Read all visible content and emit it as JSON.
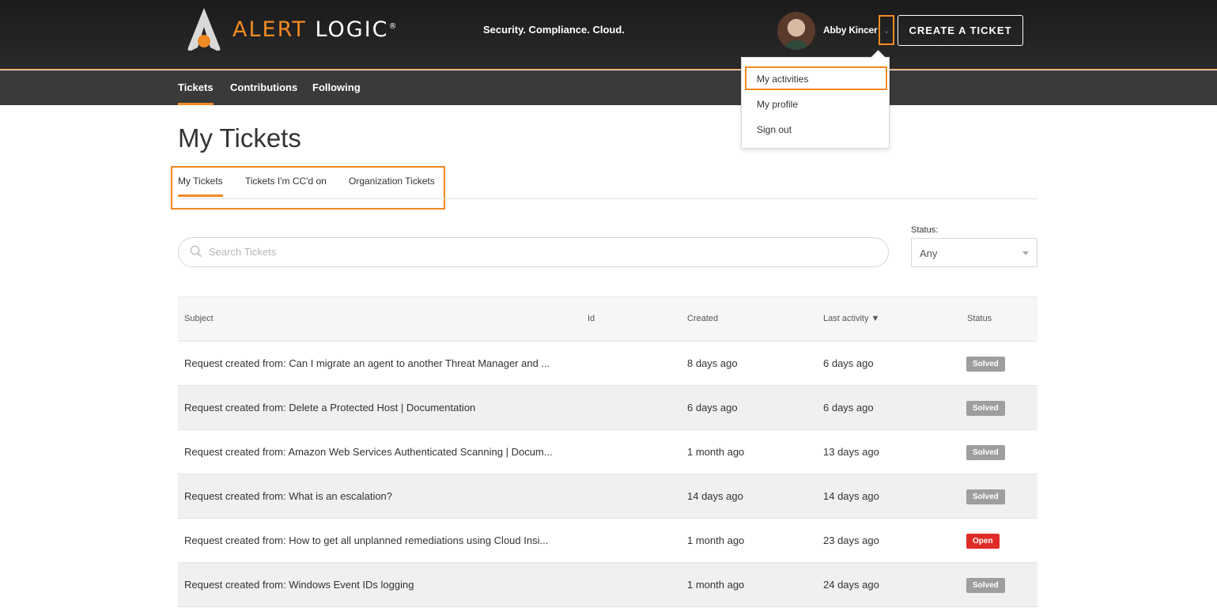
{
  "header": {
    "logo_text_alert": "ALERT",
    "logo_text_logic": "LOGIC",
    "logo_registered": "®",
    "tagline": "Security. Compliance. Cloud.",
    "user_name": "Abby Kincer",
    "create_button": "CREATE A TICKET",
    "accent_color": "#f08a24"
  },
  "subnav": {
    "items": [
      {
        "label": "Tickets",
        "active": true
      },
      {
        "label": "Contributions",
        "active": false
      },
      {
        "label": "Following",
        "active": false
      }
    ]
  },
  "user_menu": {
    "items": [
      "My activities",
      "My profile",
      "Sign out"
    ]
  },
  "page": {
    "title": "My Tickets"
  },
  "tabs": [
    {
      "label": "My Tickets",
      "active": true
    },
    {
      "label": "Tickets I'm CC'd on",
      "active": false
    },
    {
      "label": "Organization Tickets",
      "active": false
    }
  ],
  "search": {
    "placeholder": "Search Tickets"
  },
  "status_filter": {
    "label": "Status:",
    "value": "Any"
  },
  "table": {
    "headers": {
      "subject": "Subject",
      "id": "Id",
      "created": "Created",
      "last_activity": "Last activity ▼",
      "status": "Status"
    },
    "rows": [
      {
        "subject": "Request created from: Can I migrate an agent to another Threat Manager and ...",
        "created": "8 days ago",
        "last_activity": "6 days ago",
        "status": "Solved"
      },
      {
        "subject": "Request created from: Delete a Protected Host | Documentation",
        "created": "6 days ago",
        "last_activity": "6 days ago",
        "status": "Solved"
      },
      {
        "subject": "Request created from: Amazon Web Services Authenticated Scanning | Docum...",
        "created": "1 month ago",
        "last_activity": "13 days ago",
        "status": "Solved"
      },
      {
        "subject": "Request created from: What is an escalation?",
        "created": "14 days ago",
        "last_activity": "14 days ago",
        "status": "Solved"
      },
      {
        "subject": "Request created from: How to get all unplanned remediations using Cloud Insi...",
        "created": "1 month ago",
        "last_activity": "23 days ago",
        "status": "Open"
      },
      {
        "subject": "Request created from: Windows Event IDs logging",
        "created": "1 month ago",
        "last_activity": "24 days ago",
        "status": "Solved"
      }
    ]
  }
}
